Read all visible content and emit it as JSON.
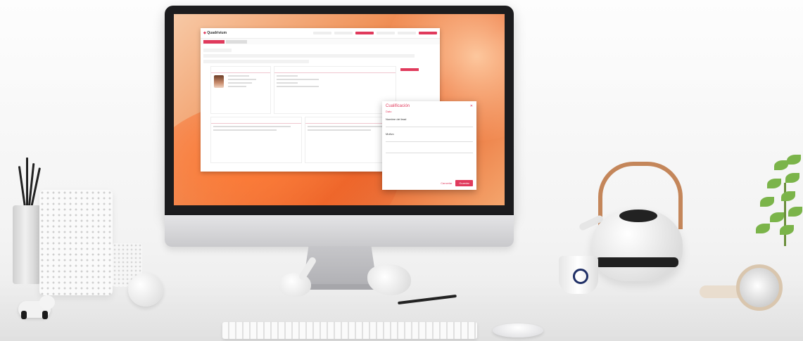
{
  "scene": {
    "description_tag": "desk-workspace",
    "colors": {
      "accent": "#e03a5c",
      "wallpaper": "#f0935a",
      "bezel": "#1c1c1e"
    }
  },
  "screen": {
    "app": {
      "logo_text": "Quadrivium",
      "brand_color": "#e03a5c"
    },
    "modal": {
      "title": "Cualificación",
      "subtitle": "Dato",
      "close_icon": "close-icon",
      "field1_label": "Nombre del lead",
      "field1_value": "",
      "field2_label": "Motivo",
      "field2_value": "",
      "field3_label": "",
      "field3_value": "",
      "cancel_label": "Cancelar",
      "save_label": "Guardar"
    }
  }
}
